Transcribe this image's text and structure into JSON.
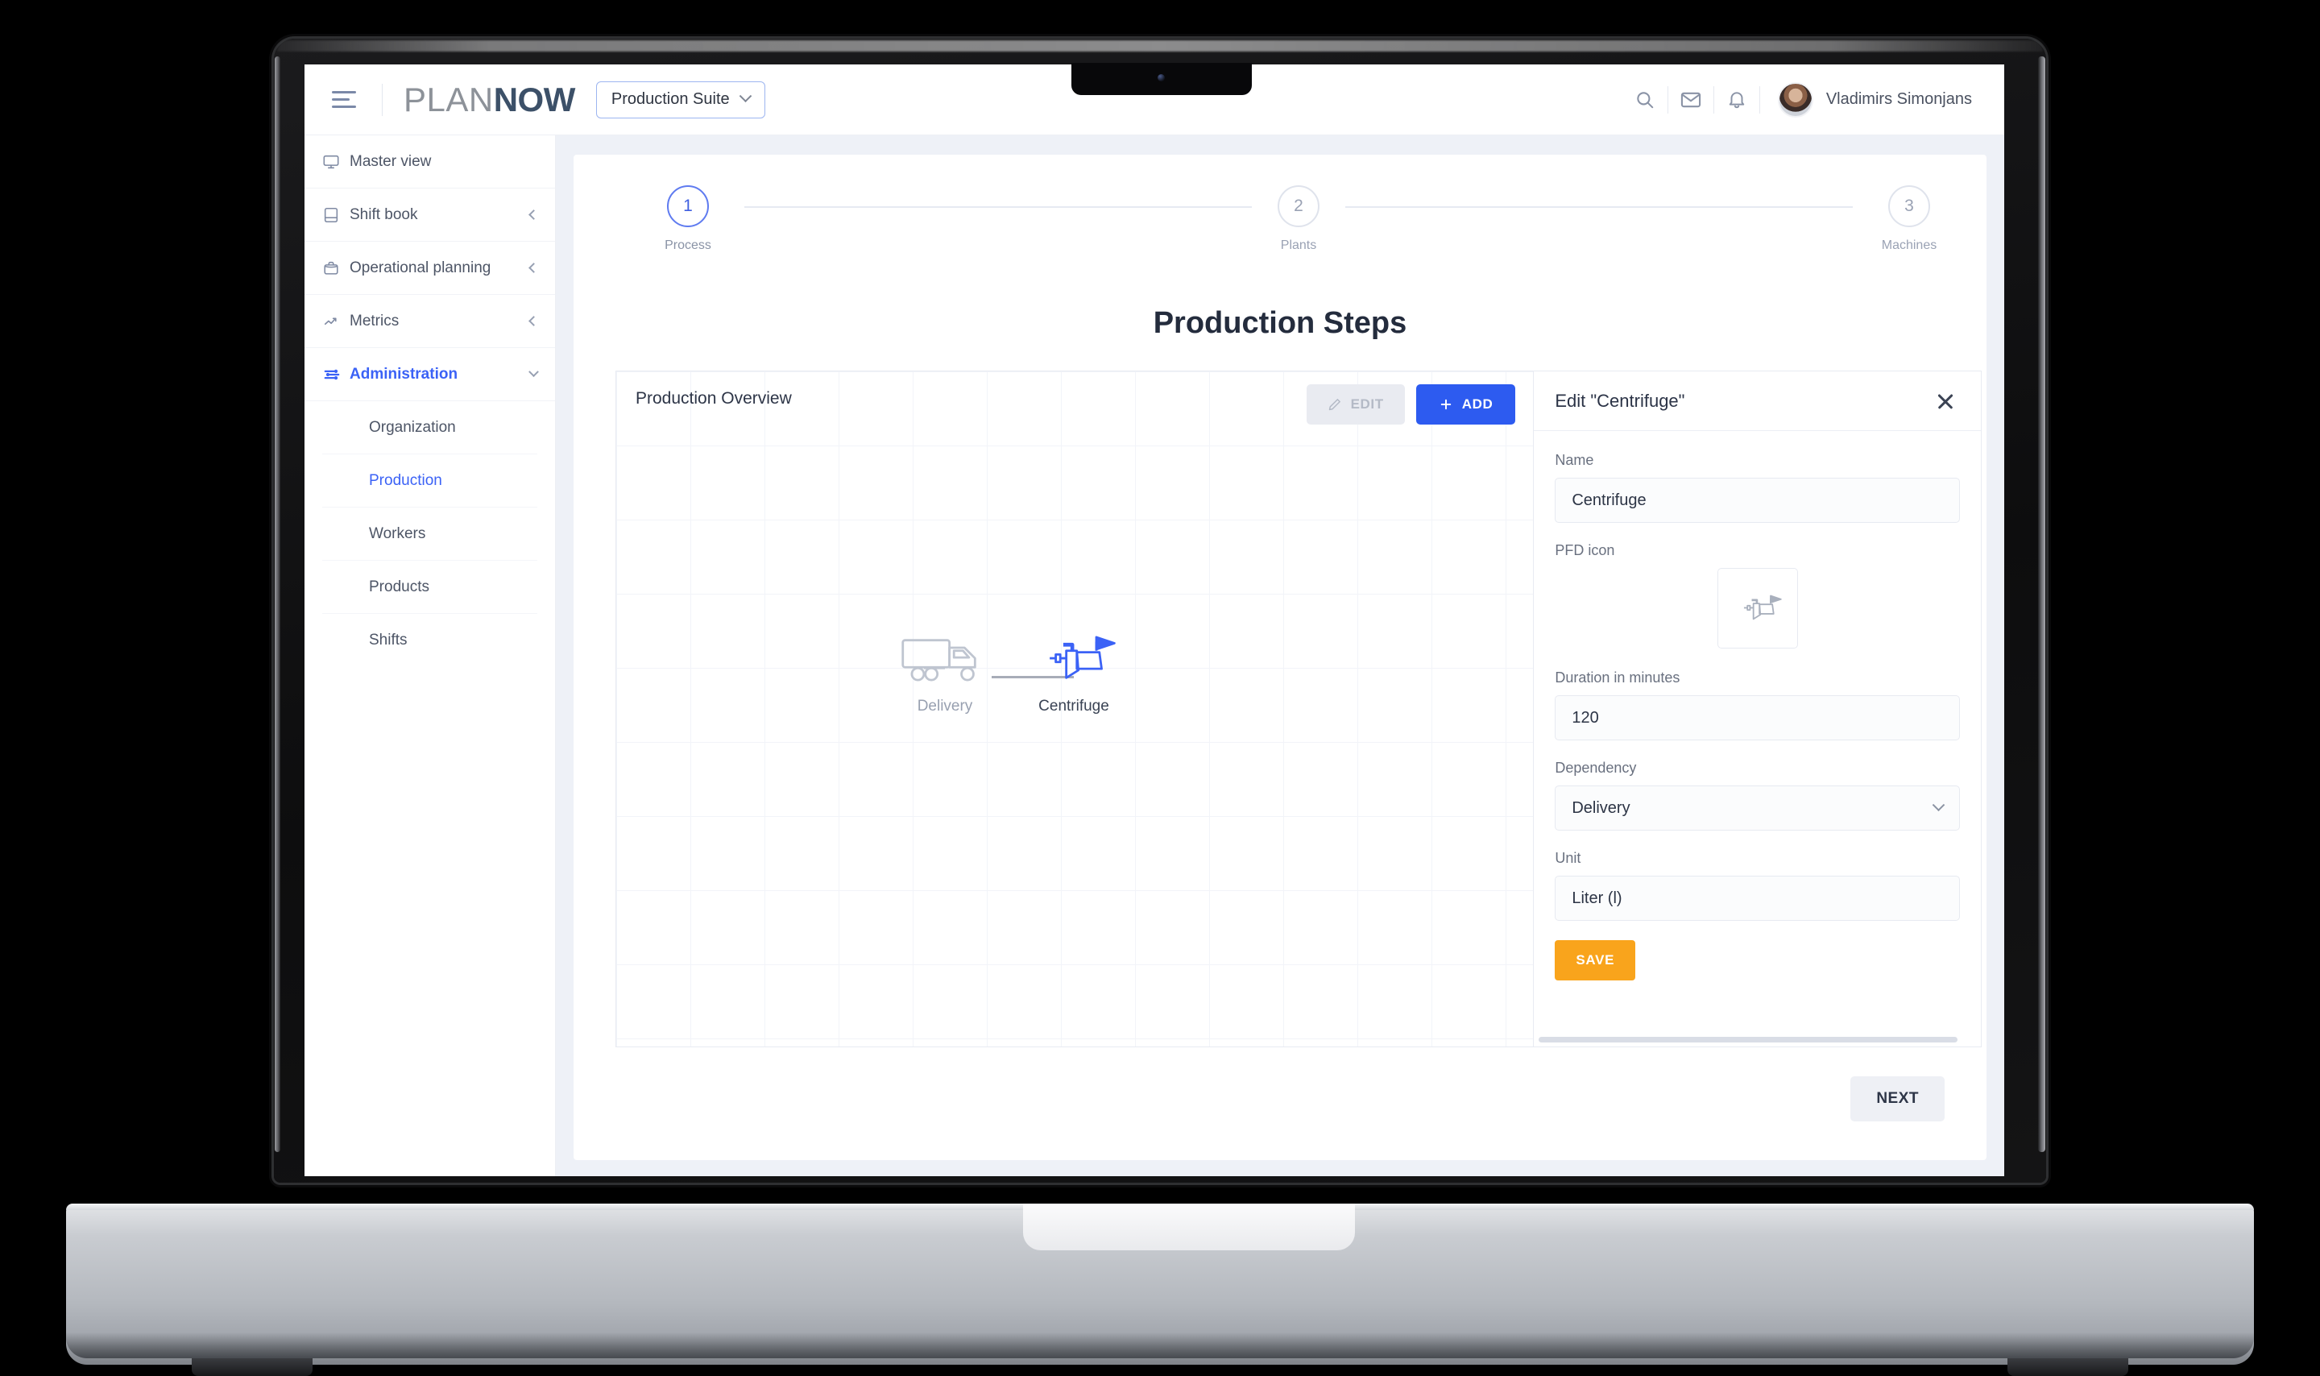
{
  "header": {
    "menu_icon": "hamburger-icon",
    "brand": {
      "part1": "PLAN",
      "part2": "NOW"
    },
    "suite_selector": {
      "label": "Production Suite",
      "caret_icon": "chevron-down-icon"
    },
    "icons": [
      {
        "name": "search-icon",
        "glyph": "search"
      },
      {
        "name": "mail-icon",
        "glyph": "mail"
      },
      {
        "name": "bell-icon",
        "glyph": "bell"
      }
    ],
    "user": {
      "name": "Vladimirs Simonjans",
      "avatar": "user-avatar"
    }
  },
  "sidebar": {
    "items": [
      {
        "label": "Master view",
        "icon": "monitor-icon",
        "expandable": false,
        "active": false
      },
      {
        "label": "Shift book",
        "icon": "book-icon",
        "expandable": true,
        "active": false
      },
      {
        "label": "Operational planning",
        "icon": "briefcase-icon",
        "expandable": true,
        "active": false
      },
      {
        "label": "Metrics",
        "icon": "trend-arrow-icon",
        "expandable": true,
        "active": false
      },
      {
        "label": "Administration",
        "icon": "sliders-icon",
        "expandable": true,
        "active": true
      }
    ],
    "sub_items": [
      {
        "label": "Organization",
        "active": false
      },
      {
        "label": "Production",
        "active": true
      },
      {
        "label": "Workers",
        "active": false
      },
      {
        "label": "Products",
        "active": false
      },
      {
        "label": "Shifts",
        "active": false
      }
    ]
  },
  "stepper": {
    "steps": [
      {
        "number": "1",
        "label": "Process",
        "active": true
      },
      {
        "number": "2",
        "label": "Plants",
        "active": false
      },
      {
        "number": "3",
        "label": "Machines",
        "active": false
      }
    ]
  },
  "page": {
    "title": "Production Steps",
    "next_label": "NEXT"
  },
  "canvas": {
    "title": "Production Overview",
    "edit_label": "EDIT",
    "edit_icon": "pencil-icon",
    "add_label": "ADD",
    "add_icon": "plus-icon",
    "nodes": [
      {
        "label": "Delivery",
        "icon": "truck-icon",
        "selected": false
      },
      {
        "label": "Centrifuge",
        "icon": "centrifuge-icon",
        "selected": true
      }
    ],
    "connection": {
      "from": "Delivery",
      "to": "Centrifuge"
    }
  },
  "edit_panel": {
    "title": "Edit \"Centrifuge\"",
    "close_icon": "close-icon",
    "fields": [
      {
        "label": "Name",
        "value": "Centrifuge",
        "type": "text"
      },
      {
        "label": "PFD icon",
        "value": "centrifuge-icon",
        "type": "icon"
      },
      {
        "label": "Duration in minutes",
        "value": "120",
        "type": "number"
      },
      {
        "label": "Dependency",
        "value": "Delivery",
        "type": "select"
      },
      {
        "label": "Unit",
        "value": "Liter (l)",
        "type": "text"
      }
    ],
    "save_label": "SAVE"
  },
  "colors": {
    "primary_blue": "#2d5bf0",
    "accent_orange": "#f9a41c",
    "active_nav": "#3b62f6",
    "brand_dark": "#3c5068",
    "page_bg": "#eef1f7"
  }
}
